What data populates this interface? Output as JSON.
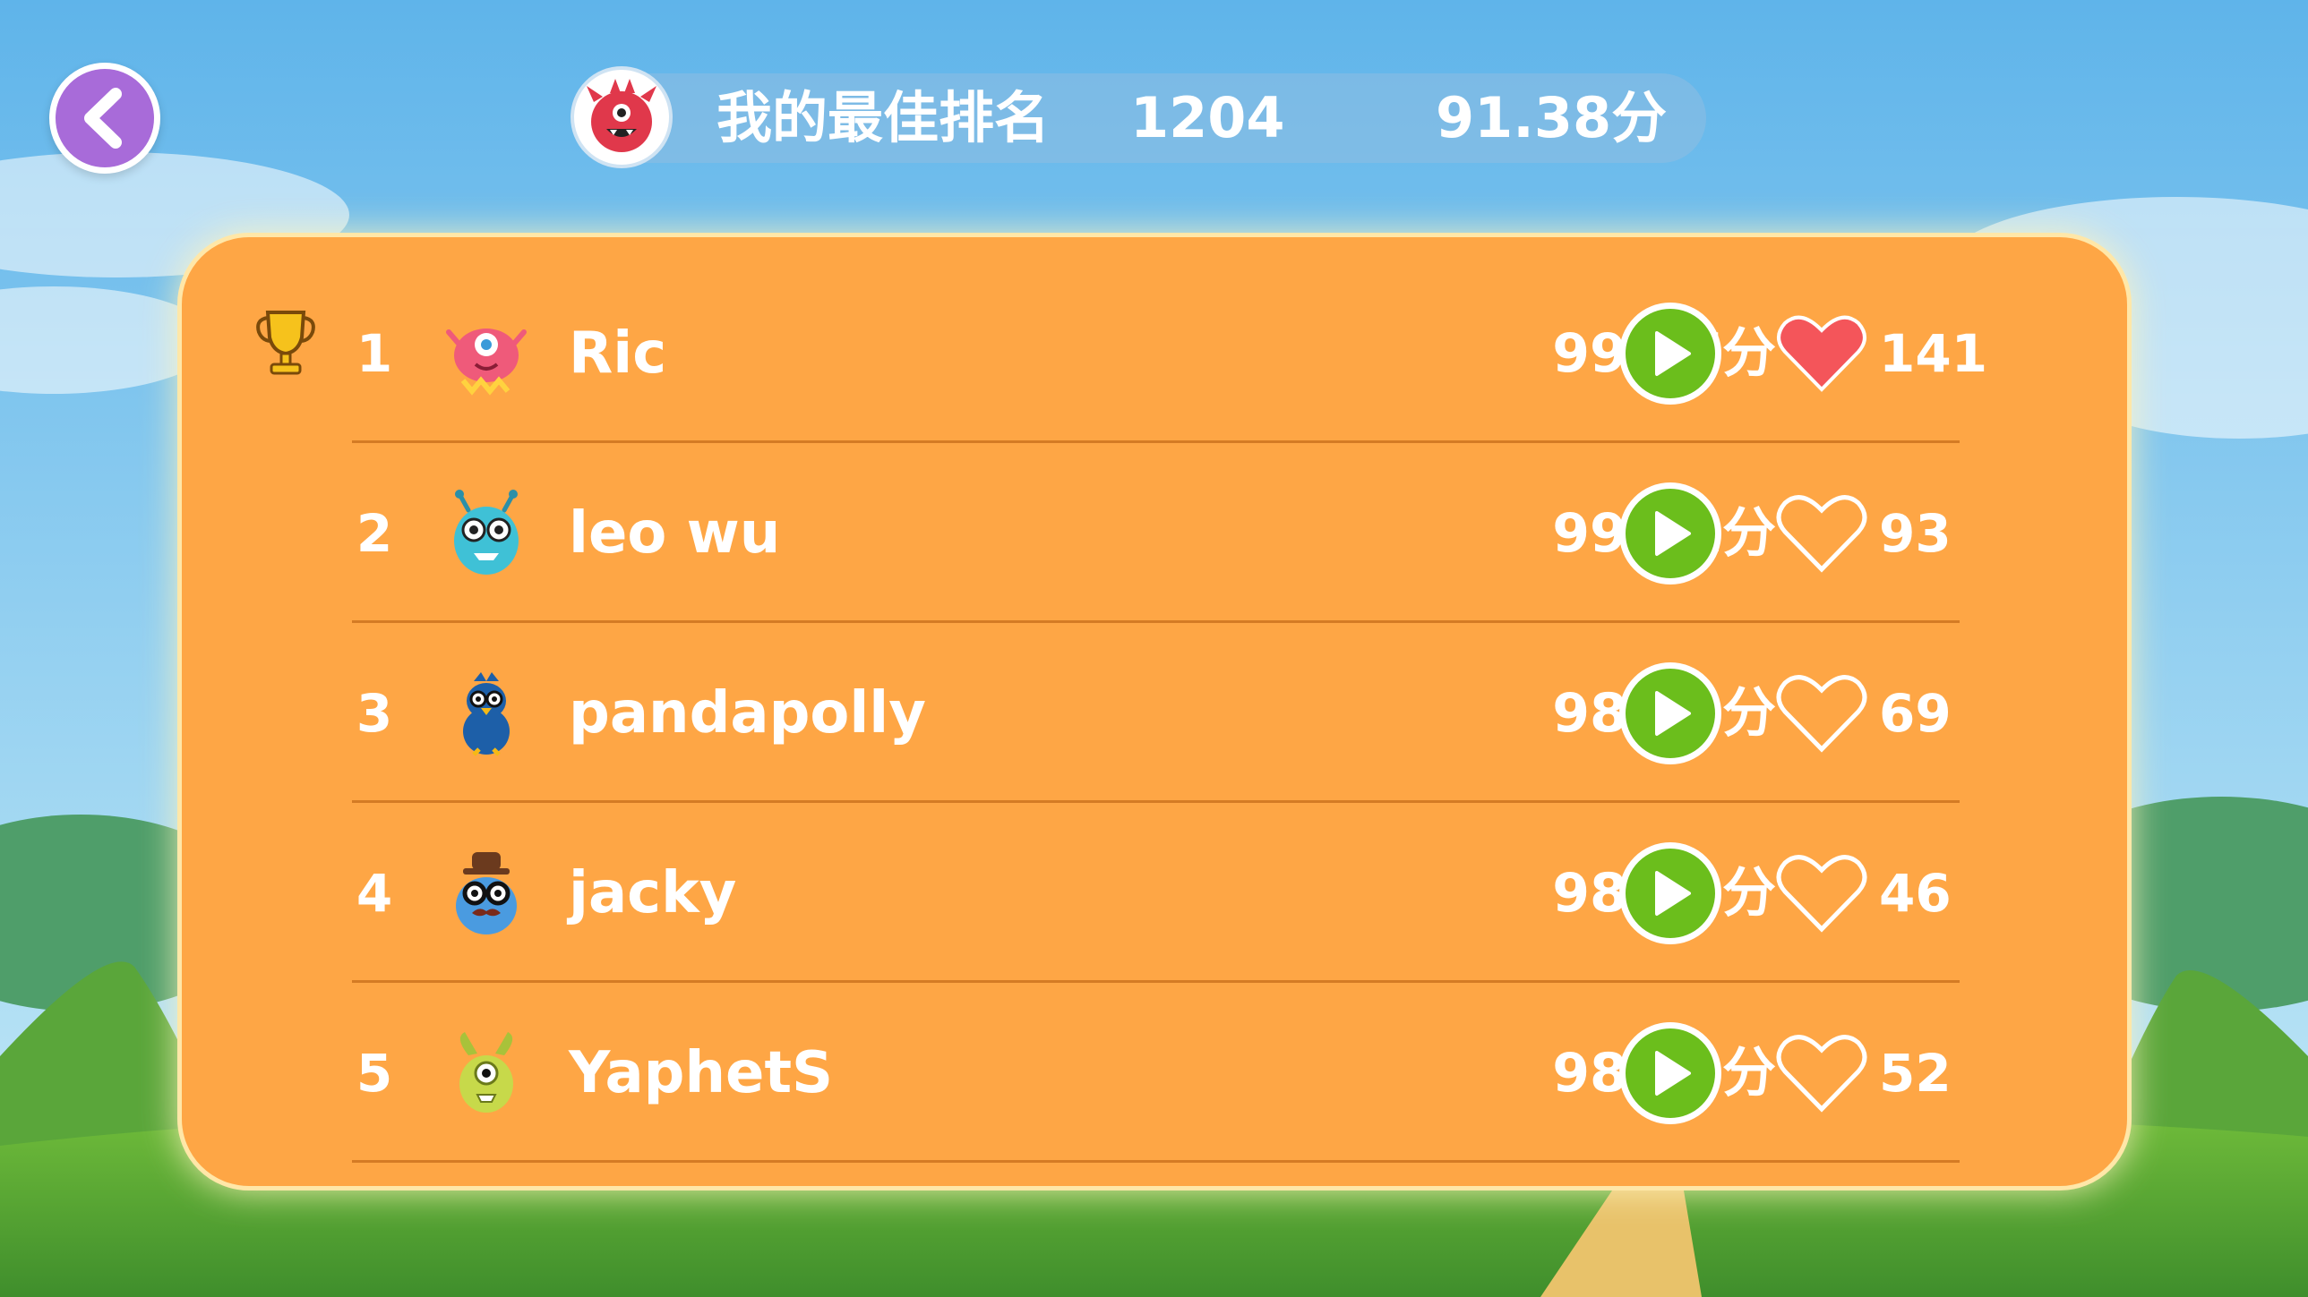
{
  "header": {
    "best_rank_label": "我的最佳排名",
    "best_rank_value": "1204",
    "best_score": "91.38分"
  },
  "leaderboard": [
    {
      "rank": "1",
      "name": "Ric",
      "score": "99.87分",
      "likes": "141",
      "liked": true,
      "avatar": "pink-monster-icon"
    },
    {
      "rank": "2",
      "name": "leo wu",
      "score": "99.41分",
      "likes": "93",
      "liked": false,
      "avatar": "teal-monster-icon"
    },
    {
      "rank": "3",
      "name": "pandapolly",
      "score": "98.88分",
      "likes": "69",
      "liked": false,
      "avatar": "blue-bird-monster-icon"
    },
    {
      "rank": "4",
      "name": "jacky",
      "score": "98.64分",
      "likes": "46",
      "liked": false,
      "avatar": "hat-glasses-monster-icon"
    },
    {
      "rank": "5",
      "name": "YaphetS",
      "score": "98.59分",
      "likes": "52",
      "liked": false,
      "avatar": "green-monster-icon"
    }
  ],
  "colors": {
    "board": "#fea645",
    "play": "#6bbe1c",
    "heart": "#f4555a",
    "back": "#a86bd9"
  }
}
